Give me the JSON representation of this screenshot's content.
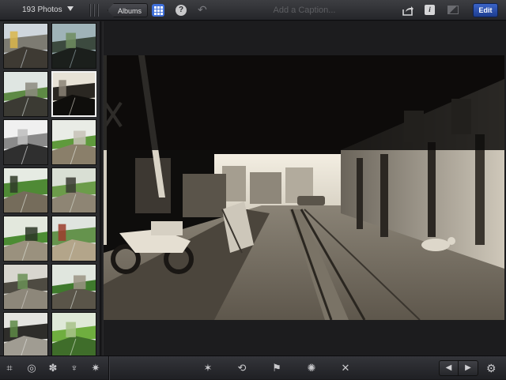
{
  "topbar": {
    "photo_count": "193 Photos",
    "albums_label": "Albums",
    "help_label": "?",
    "undo_glyph": "↶",
    "caption_placeholder": "Add a Caption...",
    "info_label": "i",
    "edit_label": "Edit",
    "icons": [
      "grid-view-icon",
      "help-icon",
      "undo-icon",
      "share-icon",
      "info-icon",
      "compare-icon"
    ]
  },
  "sidebar": {
    "thumbnails": [
      {
        "scene": "street-people",
        "selected": false
      },
      {
        "scene": "overpass-dark",
        "selected": false
      },
      {
        "scene": "green-street",
        "selected": false
      },
      {
        "scene": "railway-tunnel",
        "selected": true
      },
      {
        "scene": "bw-street",
        "selected": false
      },
      {
        "scene": "green-rail",
        "selected": false
      },
      {
        "scene": "rail-trees",
        "selected": false
      },
      {
        "scene": "shed-greenery",
        "selected": false
      },
      {
        "scene": "palm-track",
        "selected": false
      },
      {
        "scene": "market-stall",
        "selected": false
      },
      {
        "scene": "shophouse",
        "selected": false
      },
      {
        "scene": "tracks-trees",
        "selected": false
      },
      {
        "scene": "house-front",
        "selected": false
      },
      {
        "scene": "banana-leaves",
        "selected": false
      }
    ]
  },
  "main": {
    "photo_name": "railway-under-bridge-sepia"
  },
  "bottombar": {
    "left_tools": [
      "crop-icon",
      "exposure-icon",
      "color-palette-icon",
      "brushes-icon",
      "effects-icon"
    ],
    "center_tools": [
      "auto-enhance-icon",
      "rotate-icon",
      "flag-icon",
      "favorite-icon",
      "hide-icon"
    ],
    "glyphs": {
      "crop": "⌗",
      "exposure": "◎",
      "palette": "✽",
      "brushes": "♆",
      "effects": "✷",
      "enhance": "✶",
      "rotate": "⟲",
      "flag": "⚑",
      "favorite": "✺",
      "hide": "✕",
      "prev": "◀",
      "next": "▶",
      "settings": "⚙"
    }
  }
}
